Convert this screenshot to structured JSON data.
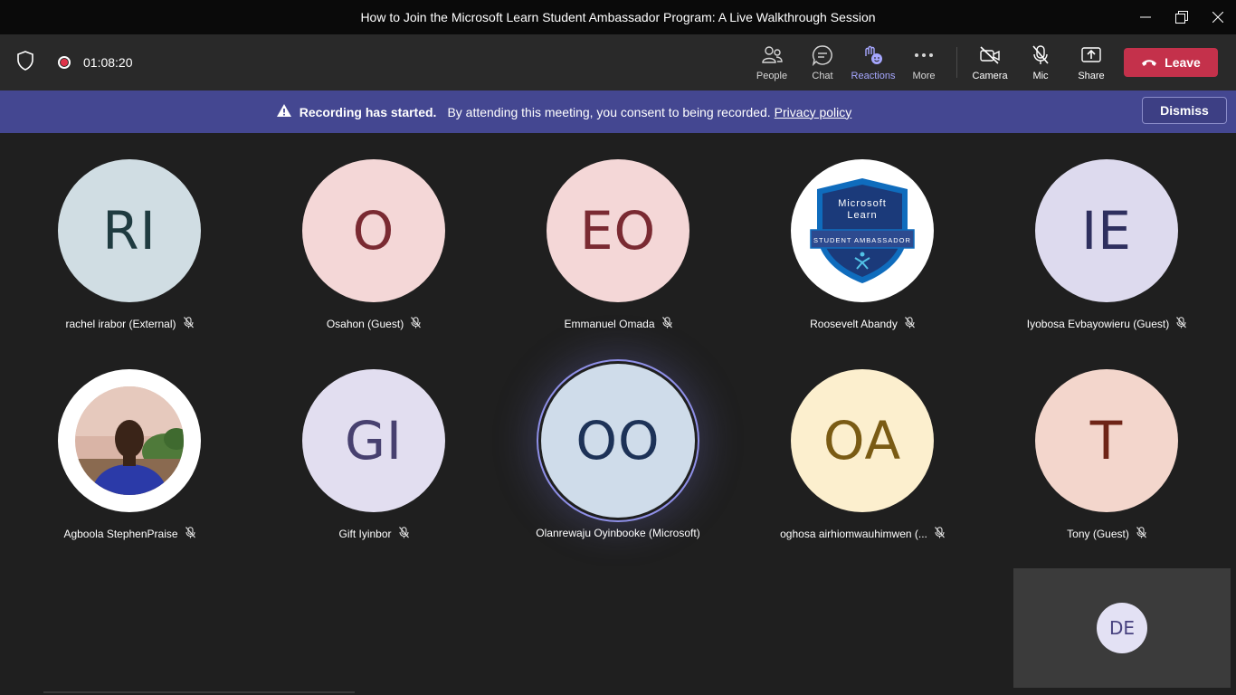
{
  "window": {
    "title": "How to Join the Microsoft Learn Student Ambassador Program: A Live Walkthrough Session"
  },
  "toolbar": {
    "timer": "01:08:20",
    "buttons": [
      {
        "label": "People",
        "icon": "people-icon"
      },
      {
        "label": "Chat",
        "icon": "chat-icon"
      },
      {
        "label": "Reactions",
        "icon": "reactions-icon",
        "active": true
      },
      {
        "label": "More",
        "icon": "more-icon"
      },
      {
        "label": "Camera",
        "icon": "camera-off-icon"
      },
      {
        "label": "Mic",
        "icon": "mic-off-icon"
      },
      {
        "label": "Share",
        "icon": "share-icon"
      }
    ],
    "leave_label": "Leave",
    "colors": {
      "leave": "#c4314b",
      "active": "#a6a7ff"
    }
  },
  "banner": {
    "heading": "Recording has started.",
    "message": "By attending this meeting, you consent to being recorded.",
    "link": "Privacy policy",
    "dismiss_label": "Dismiss",
    "color": "#444791"
  },
  "participants": [
    {
      "initials": "RI",
      "name": "rachel irabor (External)",
      "bg": "#d0dde3",
      "fg": "#1f3b40",
      "muted": true
    },
    {
      "initials": "O",
      "name": "Osahon (Guest)",
      "bg": "#f4d7d7",
      "fg": "#7a2a32",
      "muted": true
    },
    {
      "initials": "EO",
      "name": "Emmanuel Omada",
      "bg": "#f4d7d7",
      "fg": "#7a2a32",
      "muted": true
    },
    {
      "badge": {
        "line1": "Microsoft",
        "line2": "Learn",
        "ribbon": "STUDENT AMBASSADOR"
      },
      "name": "Roosevelt Abandy",
      "muted": true
    },
    {
      "initials": "IE",
      "name": "Iyobosa Evbayowieru (Guest)",
      "bg": "#dddaee",
      "fg": "#2e2f5e",
      "muted": true
    },
    {
      "photo": true,
      "name": "Agboola StephenPraise",
      "muted": true
    },
    {
      "initials": "GI",
      "name": "Gift Iyinbor",
      "bg": "#e2def0",
      "fg": "#47406f",
      "muted": true
    },
    {
      "initials": "OO",
      "name": "Olanrewaju Oyinbooke (Microsoft)",
      "bg": "#cfdcea",
      "fg": "#1d3257",
      "muted": false,
      "speaking": true
    },
    {
      "initials": "OA",
      "name": "oghosa airhiomwauhimwen (...",
      "bg": "#fcefce",
      "fg": "#7a5b14",
      "muted": true
    },
    {
      "initials": "T",
      "name": "Tony (Guest)",
      "bg": "#f3d6cc",
      "fg": "#6e2416",
      "muted": true
    }
  ],
  "self": {
    "initials": "DE"
  }
}
